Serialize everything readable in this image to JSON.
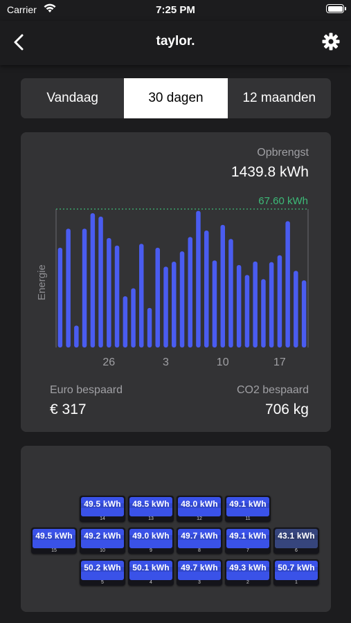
{
  "status": {
    "carrier": "Carrier",
    "time": "7:25 PM"
  },
  "nav": {
    "title": "taylor."
  },
  "tabs": [
    {
      "label": "Vandaag",
      "active": false
    },
    {
      "label": "30 dagen",
      "active": true
    },
    {
      "label": "12 maanden",
      "active": false
    }
  ],
  "summary": {
    "opbrengst_label": "Opbrengst",
    "opbrengst_value": "1439.8 kWh",
    "euro_label": "Euro bespaard",
    "euro_value": "€ 317",
    "co2_label": "CO2 bespaard",
    "co2_value": "706 kg"
  },
  "chart_data": {
    "type": "bar",
    "ylabel": "Energie",
    "max_label": "67.60 kWh",
    "max_value": 67.6,
    "ylim": [
      0,
      70
    ],
    "x_tick_labels": [
      "26",
      "3",
      "10",
      "17"
    ],
    "x_tick_positions": [
      6.5,
      13.5,
      20.5,
      27.5
    ],
    "values": [
      50.2,
      59.8,
      11.0,
      59.8,
      67.6,
      65.9,
      55.1,
      51.3,
      25.8,
      29.8,
      52.2,
      19.9,
      50.2,
      40.7,
      43.2,
      48.4,
      55.6,
      68.8,
      58.9,
      43.8,
      61.7,
      54.6,
      41.5,
      36.5,
      43.3,
      34.4,
      43.0,
      46.4,
      63.6,
      38.6,
      33.8
    ],
    "bar_color": "#4a5cf0",
    "max_line_color": "#3dbb78"
  },
  "panels": {
    "rows": [
      [
        {
          "kwh": "49.5 kWh",
          "num": "14"
        },
        {
          "kwh": "48.5 kWh",
          "num": "13"
        },
        {
          "kwh": "48.0 kWh",
          "num": "12"
        },
        {
          "kwh": "49.1 kWh",
          "num": "11"
        }
      ],
      [
        {
          "kwh": "49.5 kWh",
          "num": "15"
        },
        {
          "kwh": "49.2 kWh",
          "num": "10"
        },
        {
          "kwh": "49.0 kWh",
          "num": "9"
        },
        {
          "kwh": "49.7 kWh",
          "num": "8"
        },
        {
          "kwh": "49.1 kWh",
          "num": "7"
        },
        {
          "kwh": "43.1 kWh",
          "num": "6"
        }
      ],
      [
        {
          "kwh": "50.2 kWh",
          "num": "5"
        },
        {
          "kwh": "50.1 kWh",
          "num": "4"
        },
        {
          "kwh": "49.7 kWh",
          "num": "3"
        },
        {
          "kwh": "49.3 kWh",
          "num": "2"
        },
        {
          "kwh": "50.7 kWh",
          "num": "1"
        }
      ]
    ]
  },
  "icons": {
    "back": "chevron-left-icon",
    "settings": "gear-icon",
    "wifi": "wifi-icon",
    "battery": "battery-icon"
  }
}
